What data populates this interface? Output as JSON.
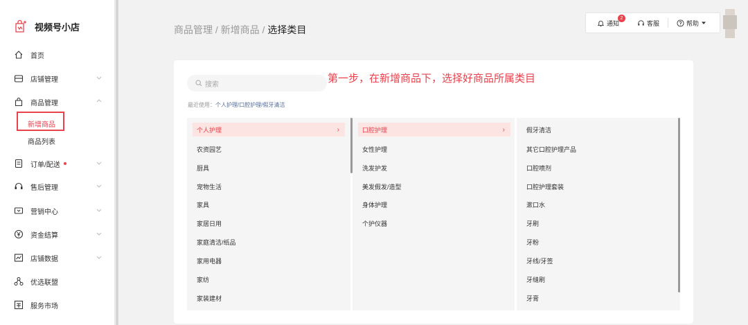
{
  "app": {
    "name": "视频号小店"
  },
  "sidebar": {
    "items": [
      {
        "label": "首页",
        "icon": "home-icon",
        "expand": ""
      },
      {
        "label": "店铺管理",
        "icon": "store-icon",
        "expand": "down"
      },
      {
        "label": "商品管理",
        "icon": "bag-icon",
        "expand": "up"
      },
      {
        "label": "订单/配送",
        "icon": "order-icon",
        "expand": "down",
        "dot": true
      },
      {
        "label": "售后管理",
        "icon": "headset-icon",
        "expand": "down"
      },
      {
        "label": "营销中心",
        "icon": "coupon-icon",
        "expand": "down"
      },
      {
        "label": "资金结算",
        "icon": "yen-icon",
        "expand": "down"
      },
      {
        "label": "店铺数据",
        "icon": "chart-icon",
        "expand": "down"
      },
      {
        "label": "优选联盟",
        "icon": "network-icon",
        "expand": ""
      },
      {
        "label": "服务市场",
        "icon": "market-icon",
        "expand": ""
      }
    ],
    "sub_items": [
      "新增商品",
      "商品列表"
    ]
  },
  "header": {
    "breadcrumb": [
      "商品管理",
      "新增商品"
    ],
    "breadcrumb_current": "选择类目",
    "sep": " / ",
    "notify_label": "通知",
    "notify_count": "2",
    "service_label": "客服",
    "help_label": "帮助"
  },
  "main": {
    "search_placeholder": "搜索",
    "instruction": "第一步，在新增商品下，选择好商品所属类目",
    "recent_label": "最近使用：",
    "recent_value": "个人护理/口腔护理/假牙清洁",
    "col1": [
      "个人护理",
      "农资园艺",
      "厨具",
      "宠物生活",
      "家具",
      "家居日用",
      "家庭清洁/纸品",
      "家用电器",
      "家纺",
      "家装建材"
    ],
    "col2": [
      "口腔护理",
      "女性护理",
      "洗发护发",
      "美发假发/造型",
      "身体护理",
      "个护仪器"
    ],
    "col3": [
      "假牙清洁",
      "其它口腔护理产品",
      "口腔喷剂",
      "口腔护理套装",
      "漱口水",
      "牙刷",
      "牙粉",
      "牙线/牙签",
      "牙缝刷",
      "牙膏"
    ],
    "arrow_glyph": "›"
  },
  "colors": {
    "accent": "#e8424c",
    "link": "#576b95"
  }
}
